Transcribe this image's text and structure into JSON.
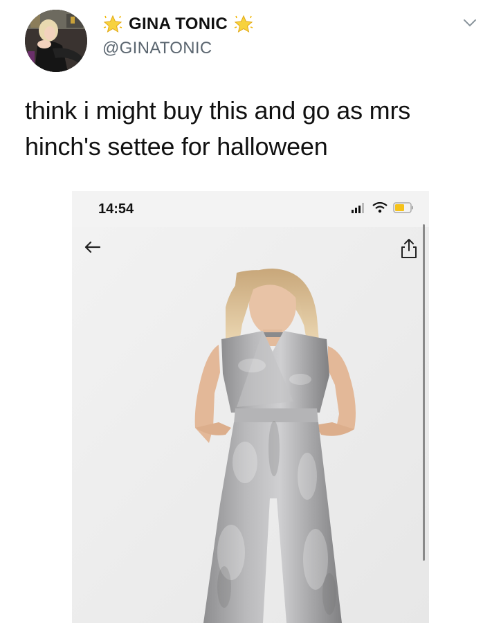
{
  "tweet": {
    "display_name": "GINA TONIC",
    "handle": "@GINATONIC",
    "text": "think i might buy this and go as mrs hinch's settee for halloween"
  },
  "embedded_screenshot": {
    "status_time": "14:54",
    "icons": [
      "back-arrow-icon",
      "share-icon",
      "signal-icon",
      "wifi-icon",
      "battery-icon"
    ]
  },
  "colors": {
    "text": "#111111",
    "handle": "#5b6670",
    "velvet": "#a9a9ab",
    "battery": "#f5c21b"
  }
}
